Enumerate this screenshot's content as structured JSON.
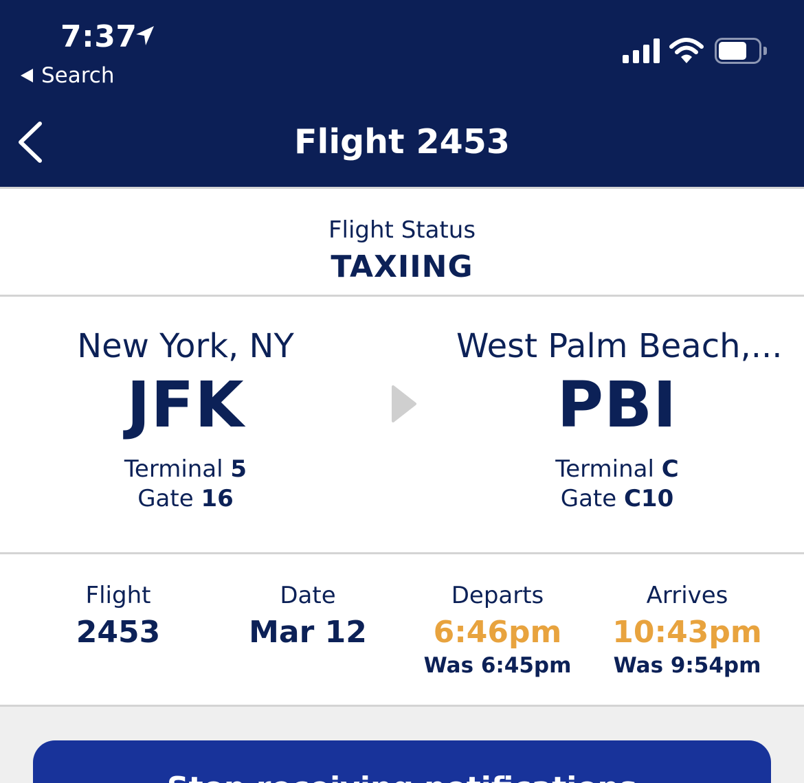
{
  "status_bar": {
    "time": "7:37",
    "back_app": "Search"
  },
  "nav": {
    "title": "Flight 2453"
  },
  "flight_status": {
    "label": "Flight Status",
    "value": "TAXIING"
  },
  "route": {
    "origin": {
      "city": "New York, NY",
      "code": "JFK",
      "terminal_label": "Terminal",
      "terminal": "5",
      "gate_label": "Gate",
      "gate": "16"
    },
    "destination": {
      "city": "West Palm Beach,...",
      "code": "PBI",
      "terminal_label": "Terminal",
      "terminal": "C",
      "gate_label": "Gate",
      "gate": "C10"
    }
  },
  "details": {
    "flight_label": "Flight",
    "flight": "2453",
    "date_label": "Date",
    "date": "Mar 12",
    "departs_label": "Departs",
    "departs": "6:46pm",
    "departs_was": "Was 6:45pm",
    "arrives_label": "Arrives",
    "arrives": "10:43pm",
    "arrives_was": "Was 9:54pm"
  },
  "cta": {
    "label": "Stop receiving notifications"
  },
  "colors": {
    "header_bg": "#0c1f56",
    "text": "#0c2157",
    "delay": "#e8a33e",
    "button": "#18339a"
  }
}
